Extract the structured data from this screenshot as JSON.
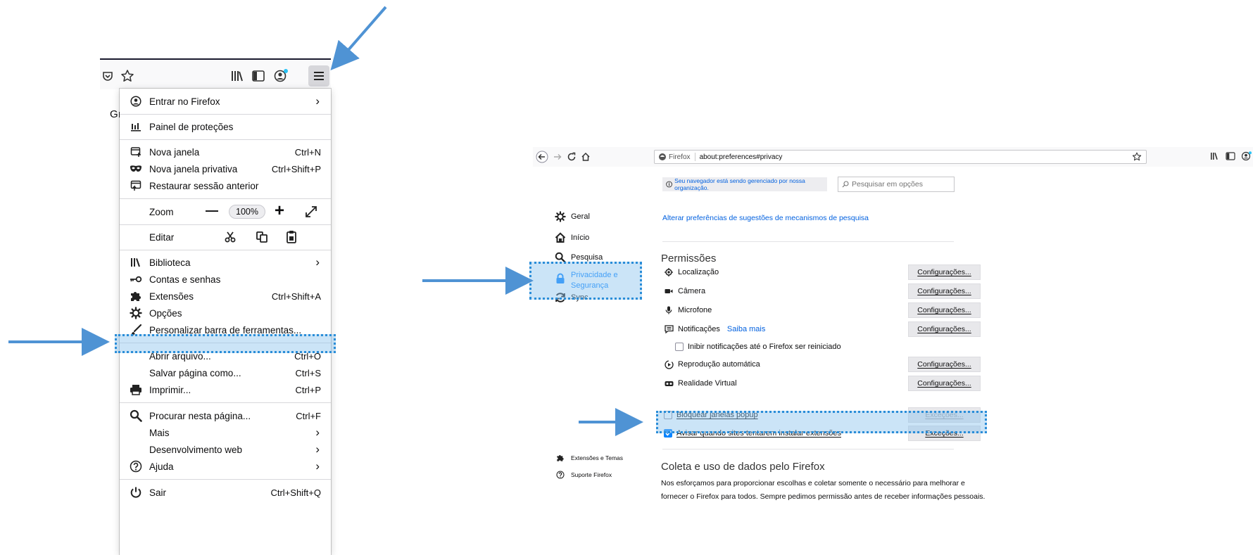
{
  "page_edge_text": "Gı",
  "menu": {
    "items": [
      {
        "id": "sign-in",
        "label": "Entrar no Firefox",
        "shortcut": "",
        "chevron": "›",
        "icon": "account-icon"
      },
      {
        "id": "protections",
        "label": "Painel de proteções",
        "shortcut": "",
        "chevron": "",
        "icon": "protections-dashboard-icon"
      },
      {
        "id": "new-window",
        "label": "Nova janela",
        "shortcut": "Ctrl+N",
        "chevron": "",
        "icon": "new-window-icon"
      },
      {
        "id": "private-window",
        "label": "Nova janela privativa",
        "shortcut": "Ctrl+Shift+P",
        "chevron": "",
        "icon": "private-mask-icon"
      },
      {
        "id": "restore-session",
        "label": "Restaurar sessão anterior",
        "shortcut": "",
        "chevron": "",
        "icon": "restore-session-icon"
      },
      {
        "id": "library",
        "label": "Biblioteca",
        "shortcut": "",
        "chevron": "›",
        "icon": "library-icon"
      },
      {
        "id": "logins",
        "label": "Contas e senhas",
        "shortcut": "",
        "chevron": "",
        "icon": "key-icon"
      },
      {
        "id": "addons",
        "label": "Extensões",
        "shortcut": "Ctrl+Shift+A",
        "chevron": "",
        "icon": "puzzle-icon"
      },
      {
        "id": "options",
        "label": "Opções",
        "shortcut": "",
        "chevron": "",
        "icon": "gear-icon"
      },
      {
        "id": "customize",
        "label": "Personalizar barra de ferramentas...",
        "shortcut": "",
        "chevron": "",
        "icon": "paintbrush-icon"
      },
      {
        "id": "open-file",
        "label": "Abrir arquivo...",
        "shortcut": "Ctrl+O",
        "chevron": "",
        "icon": ""
      },
      {
        "id": "save-page",
        "label": "Salvar página como...",
        "shortcut": "Ctrl+S",
        "chevron": "",
        "icon": ""
      },
      {
        "id": "print",
        "label": "Imprimir...",
        "shortcut": "Ctrl+P",
        "chevron": "",
        "icon": "printer-icon"
      },
      {
        "id": "find",
        "label": "Procurar nesta página...",
        "shortcut": "Ctrl+F",
        "chevron": "",
        "icon": "search-icon"
      },
      {
        "id": "more",
        "label": "Mais",
        "shortcut": "",
        "chevron": "›",
        "icon": ""
      },
      {
        "id": "web-dev",
        "label": "Desenvolvimento web",
        "shortcut": "",
        "chevron": "›",
        "icon": ""
      },
      {
        "id": "help",
        "label": "Ajuda",
        "shortcut": "",
        "chevron": "›",
        "icon": "help-icon"
      },
      {
        "id": "quit",
        "label": "Sair",
        "shortcut": "Ctrl+Shift+Q",
        "chevron": "",
        "icon": "power-icon"
      }
    ],
    "zoom": {
      "label": "Zoom",
      "minus": "—",
      "value": "100%",
      "plus": "+"
    },
    "edit": {
      "label": "Editar"
    }
  },
  "prefs": {
    "url_identity": "Firefox",
    "url": "about:preferences#privacy",
    "managed_notice": "Seu navegador está sendo gerenciado por nossa organização.",
    "search_placeholder": "Pesquisar em opções",
    "search_engine_link": "Alterar preferências de sugestões de mecanismos de pesquisa",
    "categories": [
      {
        "label": "Geral",
        "icon": "gear-icon"
      },
      {
        "label": "Início",
        "icon": "home-icon"
      },
      {
        "label": "Pesquisa",
        "icon": "search-icon"
      },
      {
        "label": "Privacidade e Segurança",
        "icon": "lock-icon"
      },
      {
        "label": "Sync",
        "icon": "sync-icon"
      }
    ],
    "footer_links": [
      {
        "label": "Extensões e Temas",
        "icon": "puzzle-icon"
      },
      {
        "label": "Suporte Firefox",
        "icon": "help-icon"
      }
    ],
    "permissions_heading": "Permissões",
    "permissions": [
      {
        "label": "Localização",
        "button": "Configurações...",
        "icon": "location-icon"
      },
      {
        "label": "Câmera",
        "button": "Configurações...",
        "icon": "camera-icon"
      },
      {
        "label": "Microfone",
        "button": "Configurações...",
        "icon": "microphone-icon"
      },
      {
        "label": "Notificações",
        "link": "Saiba mais",
        "button": "Configurações...",
        "icon": "notification-icon"
      },
      {
        "label": "Reprodução automática",
        "button": "Configurações...",
        "icon": "autoplay-icon"
      },
      {
        "label": "Realidade Virtual",
        "button": "Configurações...",
        "icon": "vr-icon"
      }
    ],
    "pause_notifications": "Inibir notificações até o Firefox ser reiniciado",
    "block_popups": {
      "label": "Bloquear janelas popup",
      "button": "Exceções...",
      "checked": false
    },
    "warn_addons": {
      "label": "Avisar quando sites tentarem instalar extensões",
      "button": "Exceções...",
      "checked": true
    },
    "data_heading": "Coleta e uso de dados pelo Firefox",
    "data_text_1": "Nos esforçamos para proporcionar escolhas e coletar somente o necessário para melhorar e",
    "data_text_2": "fornecer o Firefox para todos. Sempre pedimos permissão antes de receber informações pessoais."
  },
  "colors": {
    "arrow": "#4f93d4",
    "highlight_border": "#2a8dd8",
    "highlight_fill": "#b7d8f2",
    "checkbox_blue": "#0a84ff",
    "link_blue": "#0060df"
  }
}
